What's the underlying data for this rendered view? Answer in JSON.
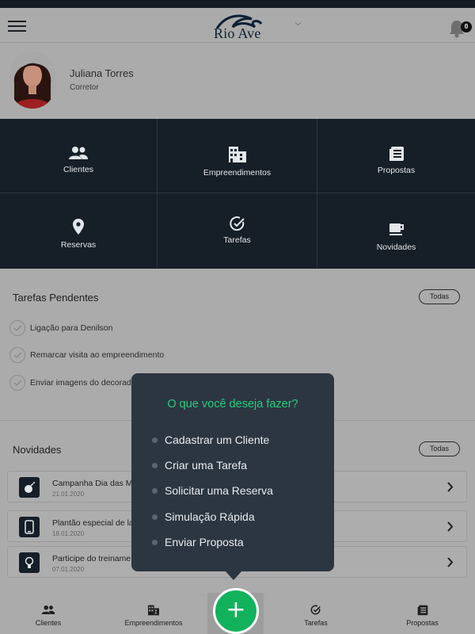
{
  "header": {
    "logo_text": "Rio Ave",
    "notification_count": "0"
  },
  "profile": {
    "name": "Juliana Torres",
    "role": "Corretor"
  },
  "tiles": [
    {
      "label": "Clientes",
      "icon": "people-icon"
    },
    {
      "label": "Empreendimentos",
      "icon": "building-icon"
    },
    {
      "label": "Propostas",
      "icon": "document-icon"
    },
    {
      "label": "Reservas",
      "icon": "location-pin-icon"
    },
    {
      "label": "Tarefas",
      "icon": "check-circle-icon"
    },
    {
      "label": "Novidades",
      "icon": "coffee-icon"
    }
  ],
  "tasks_section": {
    "title": "Tarefas Pendentes",
    "all_button": "Todas",
    "items": [
      "Ligação para Denilson",
      "Remarcar visita ao empreendimento",
      "Enviar imagens do decorado"
    ]
  },
  "news_section": {
    "title": "Novidades",
    "all_button": "Todas",
    "items": [
      {
        "title": "Campanha Dia das M",
        "date": "21.01.2020",
        "icon": "bomb-icon"
      },
      {
        "title": "Plantão especial de la",
        "date": "18.01.2020",
        "icon": "phone-icon"
      },
      {
        "title": "Participe do treiname",
        "date": "07.01.2020",
        "icon": "lightbulb-icon"
      }
    ]
  },
  "popover": {
    "title": "O que você deseja fazer?",
    "items": [
      "Cadastrar um Cliente",
      "Criar uma Tarefa",
      "Solicitar uma Reserva",
      "Simulação Rápida",
      "Enviar Proposta"
    ]
  },
  "bottom_nav": {
    "items": [
      {
        "label": "Clientes",
        "icon": "people-icon"
      },
      {
        "label": "Empreendimentos",
        "icon": "building-icon"
      },
      {
        "label": "Tarefas",
        "icon": "check-circle-icon"
      },
      {
        "label": "Propostas",
        "icon": "document-icon"
      }
    ],
    "fab_label": "+"
  },
  "colors": {
    "dark_tile": "#161e27",
    "accent_green": "#12b25c",
    "popover_title": "#22cf7b",
    "dimmed_background": "#ababab"
  }
}
